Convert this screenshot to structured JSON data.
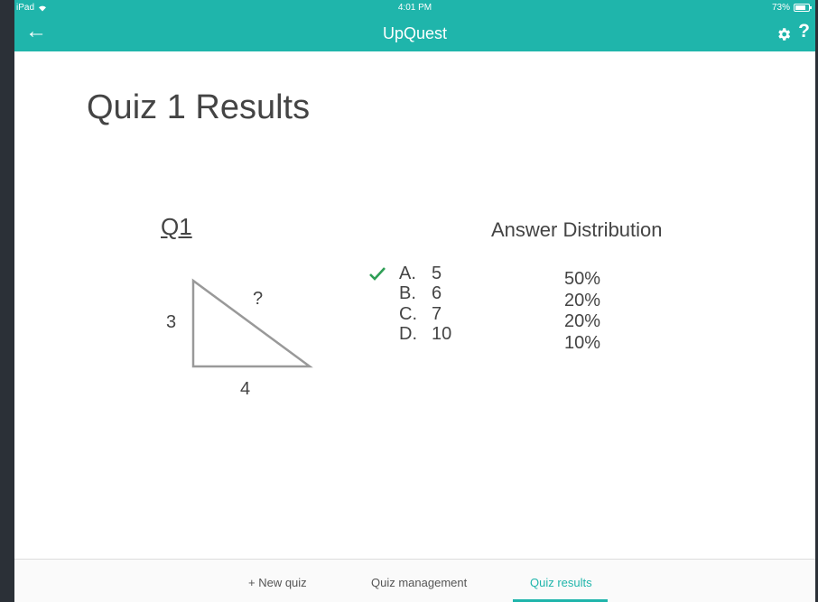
{
  "statusbar": {
    "device": "iPad",
    "time": "4:01 PM",
    "battery": "73%"
  },
  "appbar": {
    "back_icon": "←",
    "title": "UpQuest",
    "help_icon": "?"
  },
  "page": {
    "title": "Quiz 1 Results"
  },
  "question": {
    "label": "Q1",
    "hypotenuse_label": "?",
    "side_label": "3",
    "base_label": "4"
  },
  "answers": [
    {
      "letter": "A.",
      "value": "5",
      "correct": true
    },
    {
      "letter": "B.",
      "value": "6",
      "correct": false
    },
    {
      "letter": "C.",
      "value": "7",
      "correct": false
    },
    {
      "letter": "D.",
      "value": "10",
      "correct": false
    }
  ],
  "distribution": {
    "title": "Answer Distribution",
    "values": [
      "50%",
      "20%",
      "20%",
      "10%"
    ]
  },
  "bottom_nav": {
    "new_quiz": "+ New quiz",
    "quiz_management": "Quiz management",
    "quiz_results": "Quiz results",
    "active": "quiz_results"
  },
  "colors": {
    "accent": "#1fb5ab",
    "check": "#2e9e55"
  }
}
